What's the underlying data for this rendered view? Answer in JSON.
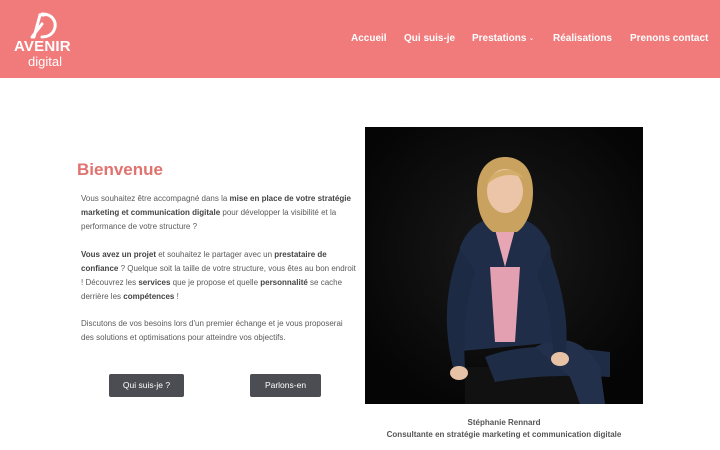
{
  "header": {
    "logo_word": "AVENIR",
    "logo_sub": "digital",
    "background": "#f17a7b"
  },
  "nav": {
    "items": [
      {
        "label": "Accueil"
      },
      {
        "label": "Qui suis-je"
      },
      {
        "label": "Prestations",
        "has_dropdown": true,
        "icon": "chevron-down-icon"
      },
      {
        "label": "Réalisations"
      },
      {
        "label": "Prenons contact"
      }
    ]
  },
  "main": {
    "title": "Bienvenue",
    "title_color": "#e0726f",
    "paragraphs": [
      [
        {
          "t": "Vous souhaitez être accompagné dans la ",
          "b": false
        },
        {
          "t": "mise en place de votre stratégie marketing et communication digitale",
          "b": true
        },
        {
          "t": " pour développer la visibilité et la performance de votre structure ?",
          "b": false
        }
      ],
      [
        {
          "t": "Vous avez un projet",
          "b": true
        },
        {
          "t": " et souhaitez le partager avec un ",
          "b": false
        },
        {
          "t": "prestataire de confiance",
          "b": true
        },
        {
          "t": " ? Quelque soit la taille de votre structure, vous êtes au bon endroit ! Découvrez les ",
          "b": false
        },
        {
          "t": "services",
          "b": true
        },
        {
          "t": " que je propose et quelle ",
          "b": false
        },
        {
          "t": "personnalité",
          "b": true
        },
        {
          "t": " se cache derrière les ",
          "b": false
        },
        {
          "t": "compétences",
          "b": true
        },
        {
          "t": " !",
          "b": false
        }
      ],
      [
        {
          "t": "Discutons de vos besoins lors d'un premier échange et je vous proposerai des solutions et optimisations pour atteindre vos objectifs.",
          "b": false
        }
      ]
    ],
    "buttons": {
      "about": "Qui suis-je ?",
      "contact": "Parlons-en"
    },
    "button_color": "#4b4d52"
  },
  "portrait": {
    "name": "Stéphanie Rennard",
    "role": "Consultante en stratégie marketing et communication digitale"
  }
}
